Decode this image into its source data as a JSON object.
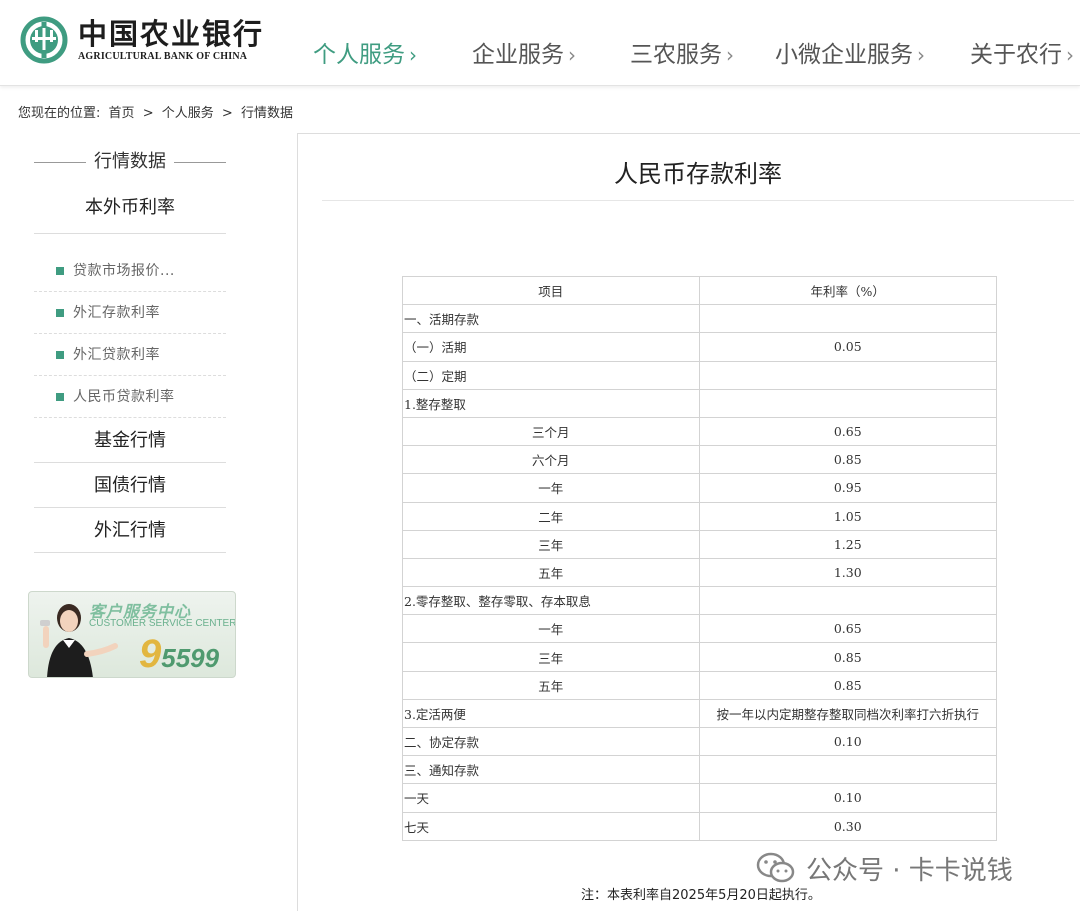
{
  "header": {
    "logo_cn": "中国农业银行",
    "logo_en": "AGRICULTURAL BANK OF CHINA",
    "nav": [
      {
        "label": "个人服务",
        "active": true
      },
      {
        "label": "企业服务",
        "active": false
      },
      {
        "label": "三农服务",
        "active": false
      },
      {
        "label": "小微企业服务",
        "active": false
      },
      {
        "label": "关于农行",
        "active": false
      }
    ],
    "chevron": "›"
  },
  "breadcrumb": {
    "prefix": "您现在的位置:",
    "items": [
      "首页",
      "个人服务",
      "行情数据"
    ],
    "separator": ">"
  },
  "sidebar": {
    "title": "行情数据",
    "section": "本外币利率",
    "items": [
      "贷款市场报价...",
      "外汇存款利率",
      "外汇贷款利率",
      "人民币贷款利率"
    ],
    "categories": [
      "基金行情",
      "国债行情",
      "外汇行情"
    ],
    "banner": {
      "cn": "客户服务中心",
      "en": "CUSTOMER SERVICE CENTER",
      "number_big": "9",
      "number_rest": "5599"
    }
  },
  "main": {
    "title": "人民币存款利率",
    "table": {
      "headers": [
        "项目",
        "年利率（%）"
      ],
      "rows": [
        {
          "item": "一、活期存款",
          "rate": "",
          "level": 0
        },
        {
          "item": "（一）活期",
          "rate": "0.05",
          "level": 1
        },
        {
          "item": "（二）定期",
          "rate": "",
          "level": 1
        },
        {
          "item": "1.整存整取",
          "rate": "",
          "level": 2
        },
        {
          "item": "三个月",
          "rate": "0.65",
          "level": 3
        },
        {
          "item": "六个月",
          "rate": "0.85",
          "level": 3
        },
        {
          "item": "一年",
          "rate": "0.95",
          "level": 3
        },
        {
          "item": "二年",
          "rate": "1.05",
          "level": 3
        },
        {
          "item": "三年",
          "rate": "1.25",
          "level": 3
        },
        {
          "item": "五年",
          "rate": "1.30",
          "level": 3
        },
        {
          "item": "2.零存整取、整存零取、存本取息",
          "rate": "",
          "level": 2
        },
        {
          "item": "一年",
          "rate": "0.65",
          "level": 3
        },
        {
          "item": "三年",
          "rate": "0.85",
          "level": 3
        },
        {
          "item": "五年",
          "rate": "0.85",
          "level": 3
        },
        {
          "item": "3.定活两便",
          "rate": "按一年以内定期整存整取同档次利率打六折执行",
          "level": 2
        },
        {
          "item": "二、协定存款",
          "rate": "0.10",
          "level": 0
        },
        {
          "item": "三、通知存款",
          "rate": "",
          "level": 0
        },
        {
          "item": "一天",
          "rate": "0.10",
          "level": 0
        },
        {
          "item": "七天",
          "rate": "0.30",
          "level": 0
        }
      ]
    },
    "note": "注：本表利率自2025年5月20日起执行。"
  },
  "watermark": {
    "text": "公众号 · 卡卡说钱"
  },
  "colors": {
    "accent": "#3f9c81",
    "nav_text": "#555555",
    "border": "#d3d3d3"
  }
}
